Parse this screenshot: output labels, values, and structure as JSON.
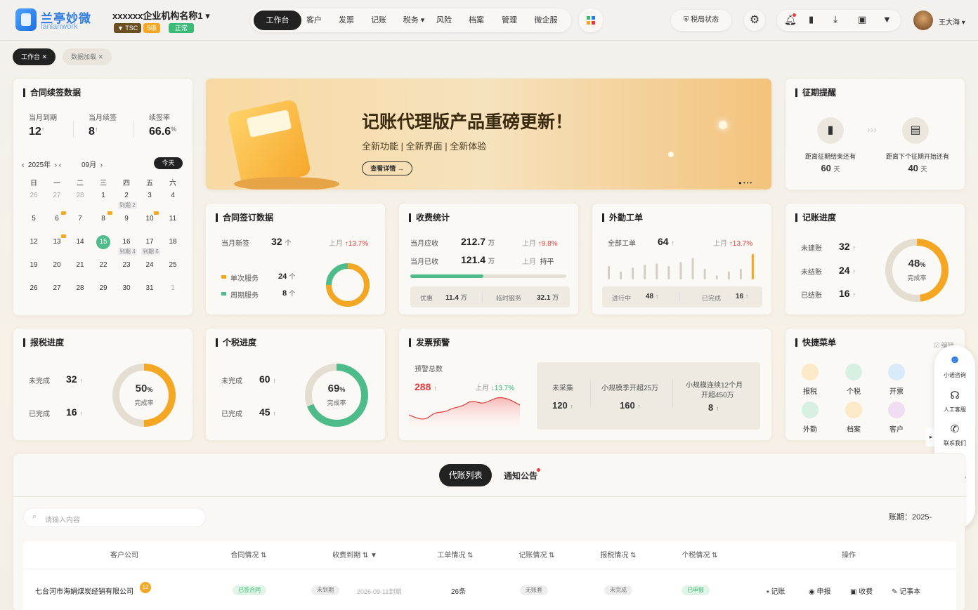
{
  "brand": {
    "cn": "兰亭妙微",
    "en": "lanlanwork"
  },
  "org": {
    "name": "xxxxxx企业机构名称1",
    "tsc": "TSC",
    "level": "5级",
    "status": "正常"
  },
  "nav": [
    "工作台",
    "客户",
    "发票",
    "记账",
    "税务",
    "风险",
    "档案",
    "管理",
    "微企服"
  ],
  "header": {
    "tax_status": "税局状态",
    "user": "王大海"
  },
  "tabs": [
    "工作台",
    "数据加载"
  ],
  "renew": {
    "title": "合同续签数据",
    "m1_label": "当月到期",
    "m1": "12",
    "m2_label": "当月续签",
    "m2": "8",
    "m3_label": "续签率",
    "m3": "66.6",
    "pct": "%",
    "arrow": "↑"
  },
  "calendar": {
    "year": "2025年",
    "month": "09月",
    "today": "今天",
    "weekdays": [
      "日",
      "一",
      "二",
      "三",
      "四",
      "五",
      "六"
    ],
    "rows": [
      [
        "26",
        "27",
        "28",
        "1",
        "2",
        "3",
        "4"
      ],
      [
        "5",
        "6",
        "7",
        "8",
        "9",
        "10",
        "11"
      ],
      [
        "12",
        "13",
        "14",
        "15",
        "16",
        "17",
        "18"
      ],
      [
        "19",
        "20",
        "21",
        "22",
        "23",
        "24",
        "25"
      ],
      [
        "26",
        "27",
        "28",
        "29",
        "30",
        "31",
        "1"
      ]
    ],
    "due": [
      "到期 2",
      "到期 4",
      "到期 6"
    ]
  },
  "banner": {
    "title": "记账代理版产品重磅更新！",
    "subtitle": "全新功能 | 全新界面 | 全新体验",
    "button": "查看详情 →"
  },
  "period": {
    "title": "征期提醒",
    "l1": "距离征期结束还有",
    "v1": "60",
    "l2": "距离下个征期开始还有",
    "v2": "40",
    "unit": "天"
  },
  "sign": {
    "title": "合同签订数据",
    "new_label": "当月新签",
    "new": "32",
    "last": "上月",
    "pct": "13.7%",
    "s1": "单次服务",
    "s1v": "24",
    "s2": "周期服务",
    "s2v": "8",
    "unit": "个"
  },
  "fee": {
    "title": "收费统计",
    "r1": "当月应收",
    "r1v": "212.7",
    "r1p": "9.8%",
    "r2": "当月已收",
    "r2v": "121.4",
    "r2p": "持平",
    "last": "上月",
    "wan": "万",
    "d1": "优惠",
    "d1v": "11.4",
    "d2": "临时服务",
    "d2v": "32.1",
    "progress": 0.47
  },
  "field": {
    "title": "外勤工单",
    "all": "全部工单",
    "allv": "64",
    "last": "上月",
    "pct": "13.7%",
    "p1": "进行中",
    "p1v": "48",
    "p2": "已完成",
    "p2v": "16",
    "bars": [
      0.5,
      0.3,
      0.45,
      0.55,
      0.6,
      0.5,
      0.65,
      0.8,
      0.4,
      0.15,
      0.3,
      0.4,
      0.95
    ]
  },
  "book": {
    "title": "记账进度",
    "a": "未建账",
    "av": "32",
    "b": "未结账",
    "bv": "24",
    "c": "已结账",
    "cv": "16",
    "rate": "48",
    "rate_label": "完成率",
    "rate_value": 0.48
  },
  "tax": {
    "title": "报税进度",
    "a": "未完成",
    "av": "32",
    "b": "已完成",
    "bv": "16",
    "rate": "50",
    "rate_label": "完成率",
    "rate_value": 0.5
  },
  "iit": {
    "title": "个税进度",
    "a": "未完成",
    "av": "60",
    "b": "已完成",
    "bv": "45",
    "rate": "69",
    "rate_label": "完成率",
    "rate_value": 0.69
  },
  "invoice": {
    "title": "发票预警",
    "total_label": "预警总数",
    "total": "288",
    "last": "上月",
    "pct": "13.7%",
    "c1": "未采集",
    "c1v": "120",
    "c2": "小规模季开超25万",
    "c2v": "160",
    "c3a": "小规模连续12个月",
    "c3b": "开超450万",
    "c3v": "8"
  },
  "quick": {
    "title": "快捷菜单",
    "edit": "编辑",
    "items": [
      "报税",
      "个税",
      "开票",
      "外勤",
      "档案",
      "客户"
    ]
  },
  "float": [
    "小诺咨询",
    "人工客服",
    "联系我们",
    "任务中心",
    "回顶部"
  ],
  "list": {
    "tabs": [
      "代账列表",
      "通知公告"
    ],
    "search": "请输入内容",
    "period": "账期：2025-",
    "headers": [
      "客户公司",
      "合同情况",
      "收费到期",
      "工单情况",
      "记账情况",
      "报税情况",
      "个税情况",
      "操作"
    ],
    "row": {
      "company": "七台河市海娟煤炭经销有限公司",
      "badge": "12",
      "contract": "已签合同",
      "fee": "未到期",
      "fee_date": "2026-09-11到期",
      "orders": "26条",
      "book": "无账套",
      "tax": "未完成",
      "iit": "已申报",
      "ops": [
        "记账",
        "申报",
        "收费",
        "记事本"
      ]
    }
  },
  "colors": {
    "accent": "#f5a623",
    "green": "#4dbb8a",
    "dark": "#222222"
  }
}
